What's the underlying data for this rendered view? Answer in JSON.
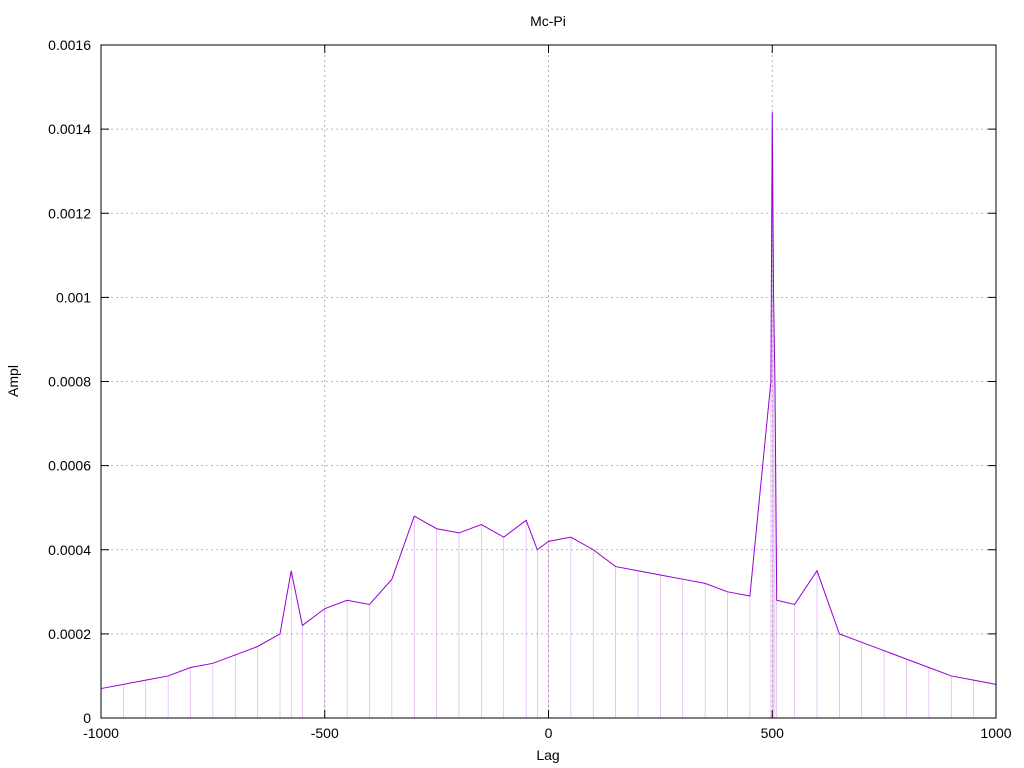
{
  "chart_data": {
    "type": "line",
    "title": "Mc-Pi",
    "xlabel": "Lag",
    "ylabel": "Ampl",
    "xlim": [
      -1000,
      1000
    ],
    "ylim": [
      0,
      0.0016
    ],
    "grid": true,
    "xticks": [
      -1000,
      -500,
      0,
      500,
      1000
    ],
    "xtick_labels": [
      "-1000",
      "-500",
      "0",
      "500",
      "1000"
    ],
    "yticks": [
      0,
      0.0002,
      0.0004,
      0.0006,
      0.0008,
      0.001,
      0.0012,
      0.0014,
      0.0016
    ],
    "ytick_labels": [
      "0",
      "0.0002",
      "0.0004",
      "0.0006",
      "0.0008",
      "0.001",
      "0.0012",
      "0.0014",
      "0.0016"
    ],
    "series": [
      {
        "color": "#9400d3",
        "x": [
          -1000,
          -950,
          -900,
          -850,
          -800,
          -750,
          -700,
          -650,
          -600,
          -575,
          -550,
          -500,
          -450,
          -400,
          -350,
          -300,
          -250,
          -200,
          -150,
          -100,
          -50,
          -25,
          0,
          50,
          100,
          150,
          200,
          250,
          300,
          350,
          400,
          450,
          497,
          500,
          503,
          506,
          510,
          550,
          600,
          650,
          700,
          750,
          800,
          850,
          900,
          950,
          1000
        ],
        "y": [
          7e-05,
          8e-05,
          9e-05,
          0.0001,
          0.00012,
          0.00013,
          0.00015,
          0.00017,
          0.0002,
          0.00035,
          0.00022,
          0.00026,
          0.00028,
          0.00027,
          0.00033,
          0.00048,
          0.00045,
          0.00044,
          0.00046,
          0.00043,
          0.00047,
          0.0004,
          0.00042,
          0.00043,
          0.0004,
          0.00036,
          0.00035,
          0.00034,
          0.00033,
          0.00032,
          0.0003,
          0.00029,
          0.0008,
          0.00144,
          0.001,
          0.0008,
          0.00028,
          0.00027,
          0.00035,
          0.0002,
          0.00018,
          0.00016,
          0.00014,
          0.00012,
          0.0001,
          9e-05,
          8e-05
        ]
      }
    ]
  }
}
